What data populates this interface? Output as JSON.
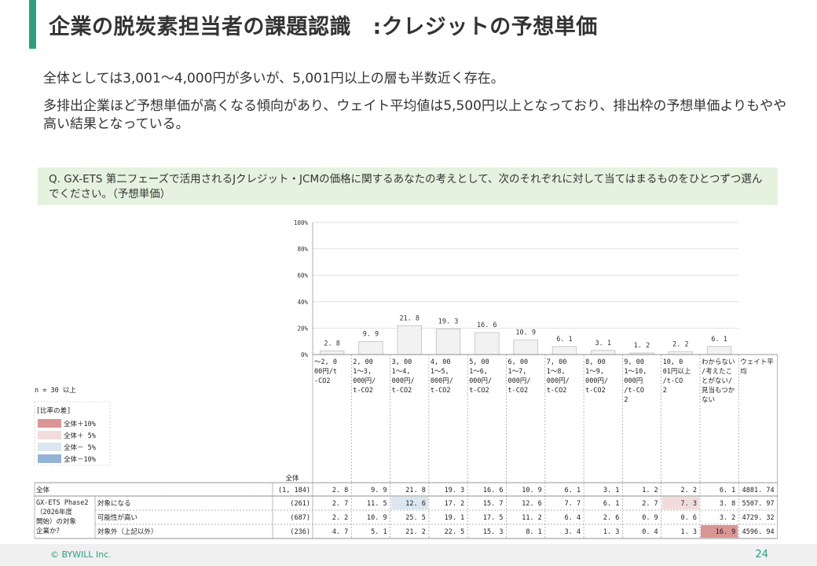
{
  "slide": {
    "title": "企業の脱炭素担当者の課題認識　:クレジットの予想単価",
    "lead1": "全体としては3,001～4,000円が多いが、5,001円以上の層も半数近く存在。",
    "lead2": "多排出企業ほど予想単価が高くなる傾向があり、ウェイト平均値は5,500円以上となっており、排出枠の予想単価よりもやや高い結果となっている。",
    "question": "Q. GX-ETS 第二フェーズで活用されるJクレジット・JCMの価格に関するあなたの考えとして、次のそれぞれに対して当てはまるものをひとつずつ選んでください。（予想単価）",
    "copyright": "© BYWILL Inc.",
    "page": "24"
  },
  "legend": {
    "n_note": "n = 30 以上",
    "title": "[比率の差]",
    "items": [
      {
        "label": "全体＋10%",
        "color": "#da9694"
      },
      {
        "label": "全体＋ 5%",
        "color": "#f2dcdb"
      },
      {
        "label": "全体－ 5%",
        "color": "#dce6f1"
      },
      {
        "label": "全体－10%",
        "color": "#95b3d7"
      }
    ]
  },
  "table": {
    "n_header": "全体",
    "columns": [
      "～2, 000円/t-CO2",
      "2, 001～3, 000円/t-CO2",
      "3, 001～4, 000円/t-CO2",
      "4, 001～5, 000円/t-CO2",
      "5, 001～6, 000円/t-CO2",
      "6, 001～7, 000円/t-CO2",
      "7, 001～8, 000円/t-CO2",
      "8, 001～9, 000円/t-CO2",
      "9, 001～10, 000円/t-CO2",
      "10, 001円以上/t-CO2",
      "わからない/考えたことがない/見当もつかない",
      "ウェイト平均"
    ],
    "group_label": "GX-ETS Phase2（2026年度開始）の対象企業か？",
    "rows": [
      {
        "label": "全体",
        "sub": "",
        "n": "(1, 184)",
        "values": [
          "2. 8",
          "9. 9",
          "21. 8",
          "19. 3",
          "16. 6",
          "10. 9",
          "6. 1",
          "3. 1",
          "1. 2",
          "2. 2",
          "6. 1",
          "4881. 74"
        ],
        "highlight": [
          null,
          null,
          null,
          null,
          null,
          null,
          null,
          null,
          null,
          null,
          null,
          null
        ]
      },
      {
        "label": "",
        "sub": "対象になる",
        "n": "(261)",
        "values": [
          "2. 7",
          "11. 5",
          "12. 6",
          "17. 2",
          "15. 7",
          "12. 6",
          "7. 7",
          "6. 1",
          "2. 7",
          "7. 3",
          "3. 8",
          "5507. 97"
        ],
        "highlight": [
          null,
          null,
          "#dce6f1",
          null,
          null,
          null,
          null,
          null,
          null,
          "#f2dcdb",
          null,
          null
        ]
      },
      {
        "label": "",
        "sub": "可能性が高い",
        "n": "(687)",
        "values": [
          "2. 2",
          "10. 9",
          "25. 5",
          "19. 1",
          "17. 5",
          "11. 2",
          "6. 4",
          "2. 6",
          "0. 9",
          "0. 6",
          "3. 2",
          "4729. 32"
        ],
        "highlight": [
          null,
          null,
          null,
          null,
          null,
          null,
          null,
          null,
          null,
          null,
          null,
          null
        ]
      },
      {
        "label": "",
        "sub": "対象外（上記以外）",
        "n": "(236)",
        "values": [
          "4. 7",
          "5. 1",
          "21. 2",
          "22. 5",
          "15. 3",
          "8. 1",
          "3. 4",
          "1. 3",
          "0. 4",
          "1. 3",
          "16. 9",
          "4596. 94"
        ],
        "highlight": [
          null,
          null,
          null,
          null,
          null,
          null,
          null,
          null,
          null,
          null,
          "#da9694",
          null
        ]
      }
    ]
  },
  "chart_data": {
    "type": "bar",
    "categories": [
      "～2, 000円/t-CO2",
      "2, 001～3, 000円/t-CO2",
      "3, 001～4, 000円/t-CO2",
      "4, 001～5, 000円/t-CO2",
      "5, 001～6, 000円/t-CO2",
      "6, 001～7, 000円/t-CO2",
      "7, 001～8, 000円/t-CO2",
      "8, 001～9, 000円/t-CO2",
      "9, 001～10, 000円/t-CO2",
      "10, 001円以上/t-CO2",
      "わからない/考えたことがない/見当もつかない"
    ],
    "values": [
      2.8,
      9.9,
      21.8,
      19.3,
      16.6,
      10.9,
      6.1,
      3.1,
      1.2,
      2.2,
      6.1
    ],
    "value_labels": [
      "2. 8",
      "9. 9",
      "21. 8",
      "19. 3",
      "16. 6",
      "10. 9",
      "6. 1",
      "3. 1",
      "1. 2",
      "2. 2",
      "6. 1"
    ],
    "ylim": [
      0,
      100
    ],
    "yticks": [
      "0%",
      "20%",
      "40%",
      "60%",
      "80%",
      "100%"
    ],
    "ytick_values": [
      0,
      20,
      40,
      60,
      80,
      100
    ],
    "grid": true,
    "bar_color": "#f2f2f2",
    "bar_edge": "#bfbfbf"
  }
}
